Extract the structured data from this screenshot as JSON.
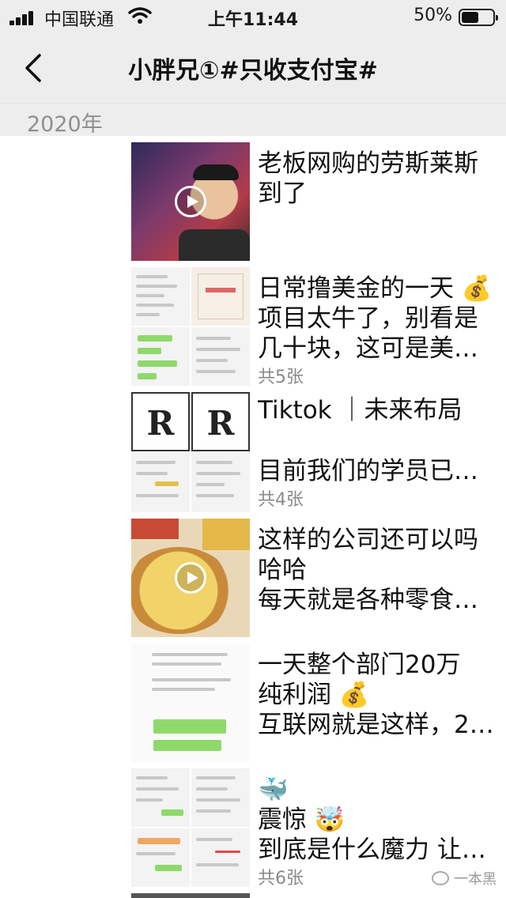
{
  "status_bar": {
    "carrier": "中国联通",
    "time": "上午11:44",
    "battery_percent": "50%",
    "battery_level": 0.5
  },
  "nav": {
    "title": "小胖兄①#只收支付宝#"
  },
  "year": "2020年",
  "posts": [
    {
      "lines": [
        "老板网购的劳斯莱斯",
        "到了"
      ],
      "count": "",
      "thumb": "video"
    },
    {
      "lines": [
        "日常撸美金的一天 💰",
        "项目太牛了，别看是",
        "几十块，这可是美…"
      ],
      "count": "共5张",
      "thumb": "grid"
    },
    {
      "lines": [
        "Tiktok ｜未来布局"
      ],
      "count": "",
      "thumb": "logo-grid"
    },
    {
      "lines": [
        "目前我们的学员已…"
      ],
      "count": "共4张",
      "thumb": "grid"
    },
    {
      "lines": [
        "这样的公司还可以吗",
        "哈哈",
        "每天就是各种零食…"
      ],
      "count": "",
      "thumb": "video"
    },
    {
      "lines": [
        "一天整个部门20万",
        "纯利润 💰",
        "互联网就是这样，2…"
      ],
      "count": "",
      "thumb": "chat"
    },
    {
      "lines": [
        "🐳",
        "震惊 🤯",
        "到底是什么魔力 让…"
      ],
      "count": "共6张",
      "thumb": "grid"
    }
  ],
  "watermark": "一本黑",
  "colors": {
    "header_bg": "#ededed",
    "meta_gray": "#8a8a8a",
    "green": "#8fd96b"
  }
}
